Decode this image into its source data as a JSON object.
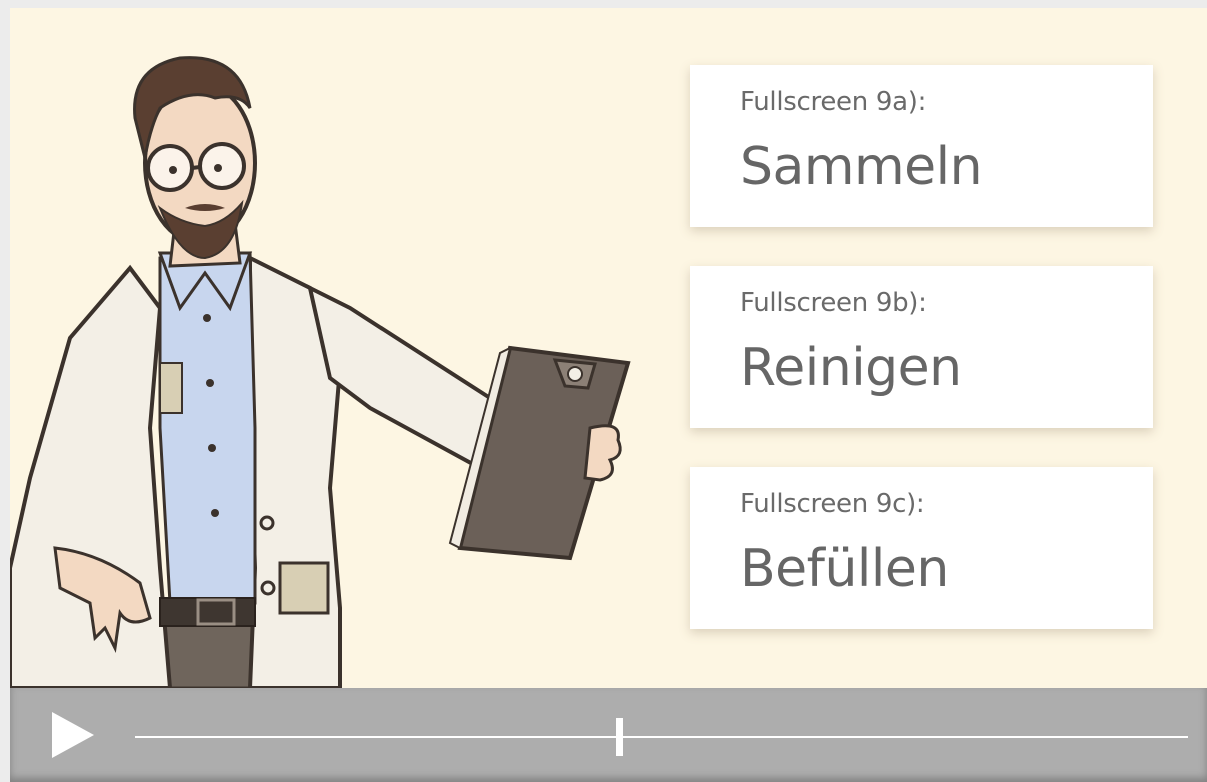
{
  "cards": [
    {
      "label": "Fullscreen 9a):",
      "title": "Sammeln"
    },
    {
      "label": "Fullscreen 9b):",
      "title": "Reinigen"
    },
    {
      "label": "Fullscreen 9c):",
      "title": "Befüllen"
    }
  ],
  "player": {
    "play_icon": "play-icon",
    "progress_fraction": 0.46
  },
  "colors": {
    "stage_bg": "#fdf6e3",
    "controls_bg": "#adadad",
    "card_text": "#666666"
  }
}
